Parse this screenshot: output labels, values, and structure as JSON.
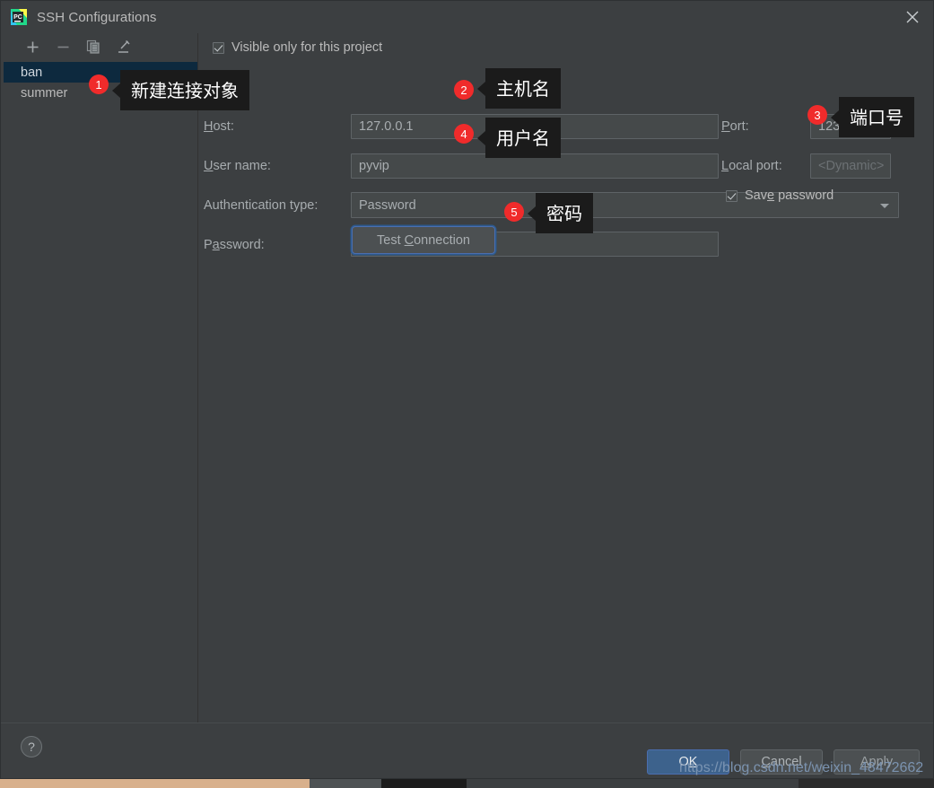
{
  "window": {
    "title": "SSH Configurations",
    "app_icon": "pycharm-icon",
    "close_icon": "close-icon"
  },
  "sidebar": {
    "toolbar": [
      {
        "name": "add-button",
        "icon": "plus-icon"
      },
      {
        "name": "remove-button",
        "icon": "minus-icon"
      },
      {
        "name": "copy-button",
        "icon": "copy-icon"
      },
      {
        "name": "edit-button",
        "icon": "pencil-icon"
      }
    ],
    "items": [
      {
        "label": "ban",
        "selected": true
      },
      {
        "label": "summer",
        "selected": false
      }
    ]
  },
  "form": {
    "visible_only": {
      "label": "Visible only for this project",
      "checked": true
    },
    "host": {
      "label": "Host:",
      "mnemonic": "H",
      "value": "127.0.0.1"
    },
    "port": {
      "label": "Port:",
      "mnemonic": "P",
      "value": "1234"
    },
    "user_name": {
      "label": "User name:",
      "mnemonic": "U",
      "value": "pyvip"
    },
    "local_port": {
      "label": "Local port:",
      "mnemonic": "L",
      "value": "<Dynamic>",
      "is_placeholder": true
    },
    "auth_type": {
      "label": "Authentication type:",
      "value": "Password",
      "arrow_icon": "chevron-down-icon"
    },
    "password": {
      "label": "Password:",
      "mnemonic": "a",
      "value": "•••••••••"
    },
    "save_password": {
      "label": "Save password",
      "mnemonic": "e",
      "checked": true
    },
    "test_connection": {
      "label_before": "Test ",
      "mnemonic": "C",
      "label_after": "onnection"
    }
  },
  "footer": {
    "help_icon": "question-mark-icon",
    "ok": {
      "before": "O",
      "mnemonic": "K",
      "after": ""
    },
    "cancel": {
      "before": "",
      "mnemonic": "C",
      "after": "ancel"
    },
    "apply": {
      "before": "",
      "mnemonic": "A",
      "after": "pply"
    }
  },
  "annotations": {
    "badges": [
      {
        "n": "1",
        "tip": "新建连接对象"
      },
      {
        "n": "2",
        "tip": "主机名"
      },
      {
        "n": "3",
        "tip": "端口号"
      },
      {
        "n": "4",
        "tip": "用户名"
      },
      {
        "n": "5",
        "tip": "密码"
      }
    ]
  },
  "watermark": "https://blog.csdn.net/weixin_48472662",
  "colors": {
    "window_bg": "#3c3f41",
    "field_bg": "#45494a",
    "selection": "#0d293e",
    "accent_blue": "#4b6eaf",
    "ok_blue": "#3d628c",
    "badge_red": "#f02b2b",
    "tooltip_bg": "#1b1b1b",
    "text": "#a7acaf"
  }
}
